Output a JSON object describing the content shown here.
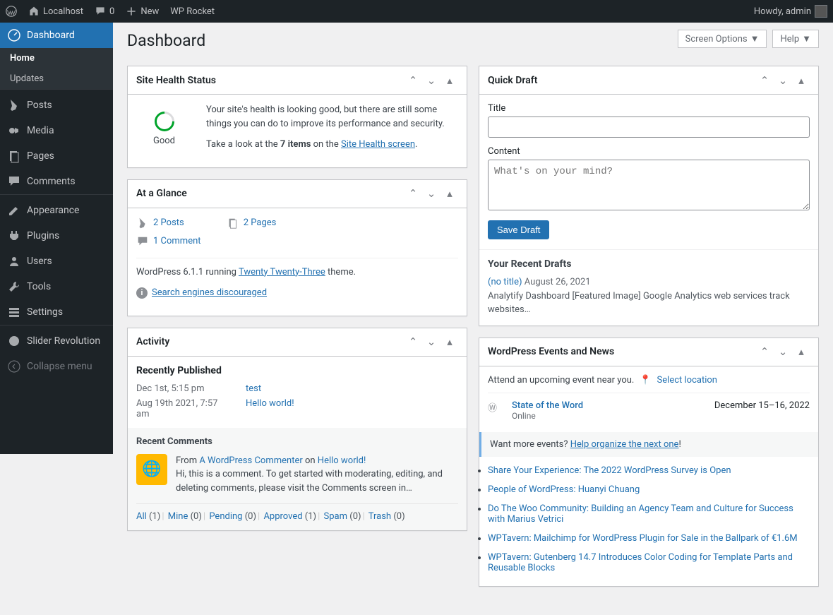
{
  "adminbar": {
    "site": "Localhost",
    "comments": "0",
    "new": "New",
    "wprocket": "WP Rocket",
    "howdy": "Howdy, admin"
  },
  "screen_options": "Screen Options",
  "help": "Help",
  "page_title": "Dashboard",
  "menu": {
    "dashboard": "Dashboard",
    "home": "Home",
    "updates": "Updates",
    "posts": "Posts",
    "media": "Media",
    "pages": "Pages",
    "comments": "Comments",
    "appearance": "Appearance",
    "plugins": "Plugins",
    "users": "Users",
    "tools": "Tools",
    "settings": "Settings",
    "slider": "Slider Revolution",
    "collapse": "Collapse menu"
  },
  "site_health": {
    "title": "Site Health Status",
    "label": "Good",
    "msg": "Your site's health is looking good, but there are still some things you can do to improve its performance and security.",
    "p2a": "Take a look at the ",
    "items": "7 items",
    "p2b": " on the ",
    "link": "Site Health screen",
    "dot": "."
  },
  "glance": {
    "title": "At a Glance",
    "posts": "2 Posts",
    "pages": "2 Pages",
    "comments": "1 Comment",
    "version_pre": "WordPress 6.1.1 running ",
    "theme": "Twenty Twenty-Three",
    "version_post": " theme.",
    "search": "Search engines discouraged"
  },
  "activity": {
    "title": "Activity",
    "recently": "Recently Published",
    "rows": [
      {
        "date": "Dec 1st, 5:15 pm",
        "title": "test"
      },
      {
        "date": "Aug 19th 2021, 7:57 am",
        "title": "Hello world!"
      }
    ],
    "recent_comments": "Recent Comments",
    "comment": {
      "from": "From ",
      "author": "A WordPress Commenter",
      "on": " on ",
      "post": "Hello world!",
      "body": "Hi, this is a comment. To get started with moderating, editing, and deleting comments, please visit the Comments screen in…"
    },
    "filters": {
      "all": "All",
      "all_c": "(1)",
      "mine": "Mine",
      "mine_c": "(0)",
      "pending": "Pending",
      "pending_c": "(0)",
      "approved": "Approved",
      "approved_c": "(1)",
      "spam": "Spam",
      "spam_c": "(0)",
      "trash": "Trash",
      "trash_c": "(0)"
    }
  },
  "quickdraft": {
    "title": "Quick Draft",
    "title_label": "Title",
    "content_label": "Content",
    "placeholder": "What's on your mind?",
    "save": "Save Draft",
    "recent": "Your Recent Drafts",
    "draft_title": "(no title)",
    "draft_date": "August 26, 2021",
    "draft_excerpt": "Analytify Dashboard [Featured Image] Google Analytics web services track websites…"
  },
  "events": {
    "title": "WordPress Events and News",
    "attend": "Attend an upcoming event near you.",
    "select": "Select location",
    "ev_title": "State of the Word",
    "ev_loc": "Online",
    "ev_date": "December 15–16, 2022",
    "want_pre": "Want more events? ",
    "want_link": "Help organize the next one",
    "want_post": "!",
    "news": [
      "Share Your Experience: The 2022 WordPress Survey is Open",
      "People of WordPress: Huanyi Chuang",
      "Do The Woo Community: Building an Agency Team and Culture for Success with Marius Vetrici",
      "WPTavern: Mailchimp for WordPress Plugin for Sale in the Ballpark of €1.6M",
      "WPTavern: Gutenberg 14.7 Introduces Color Coding for Template Parts and Reusable Blocks"
    ]
  }
}
